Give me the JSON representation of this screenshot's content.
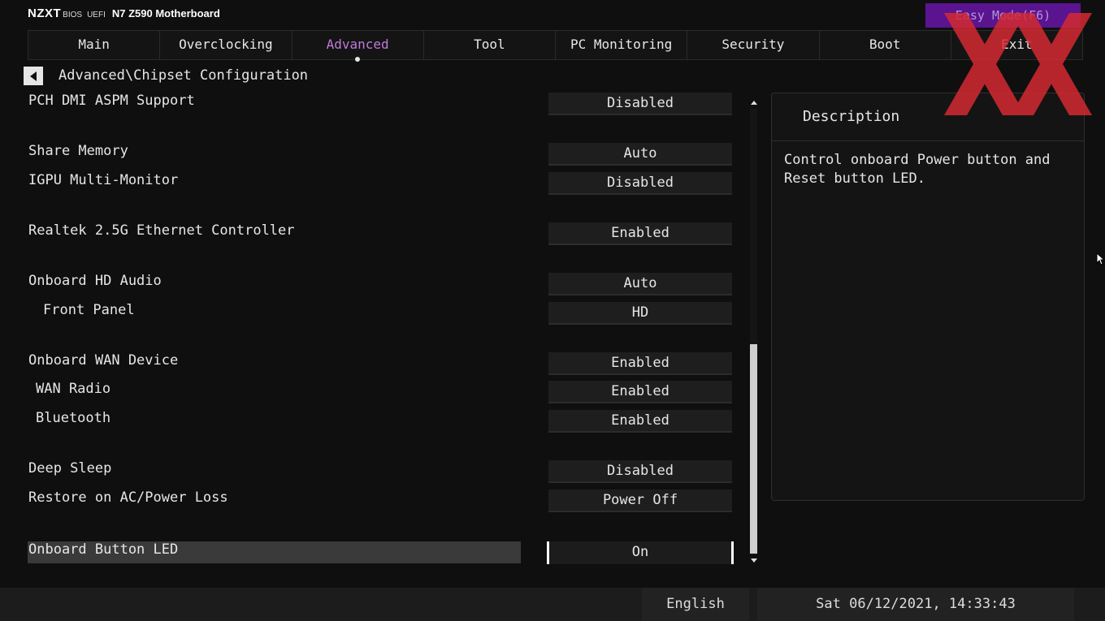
{
  "brand": {
    "logo": "NZXT",
    "bios": "BIOS",
    "uefi": "UEFI",
    "model": "N7 Z590 Motherboard"
  },
  "easy_mode": "Easy Mode(F6)",
  "tabs": [
    {
      "label": "Main"
    },
    {
      "label": "Overclocking"
    },
    {
      "label": "Advanced",
      "active": true
    },
    {
      "label": "Tool"
    },
    {
      "label": "PC Monitoring"
    },
    {
      "label": "Security"
    },
    {
      "label": "Boot"
    },
    {
      "label": "Exit"
    }
  ],
  "breadcrumb": "Advanced\\Chipset Configuration",
  "settings": [
    {
      "label": "PCH DMI ASPM Support",
      "value": "Disabled"
    },
    {
      "label": "Share Memory",
      "value": "Auto"
    },
    {
      "label": "IGPU Multi-Monitor",
      "value": "Disabled"
    },
    {
      "label": "Realtek 2.5G Ethernet Controller",
      "value": "Enabled"
    },
    {
      "label": "Onboard HD Audio",
      "value": "Auto"
    },
    {
      "label": "Front Panel",
      "value": "HD"
    },
    {
      "label": "Onboard WAN Device",
      "value": "Enabled"
    },
    {
      "label": "WAN Radio",
      "value": "Enabled"
    },
    {
      "label": "Bluetooth",
      "value": "Enabled"
    },
    {
      "label": "Deep Sleep",
      "value": "Disabled"
    },
    {
      "label": "Restore on AC/Power Loss",
      "value": "Power Off"
    },
    {
      "label": "Onboard Button LED",
      "value": "On",
      "selected": true
    }
  ],
  "description": {
    "title": "Description",
    "text": "Control onboard Power button and Reset button LED."
  },
  "footer": {
    "language": "English",
    "datetime": "Sat 06/12/2021, 14:33:43"
  },
  "colors": {
    "accent": "#c07ad8",
    "easy_mode_bg": "#5a1490",
    "watermark": "#d42a32"
  }
}
